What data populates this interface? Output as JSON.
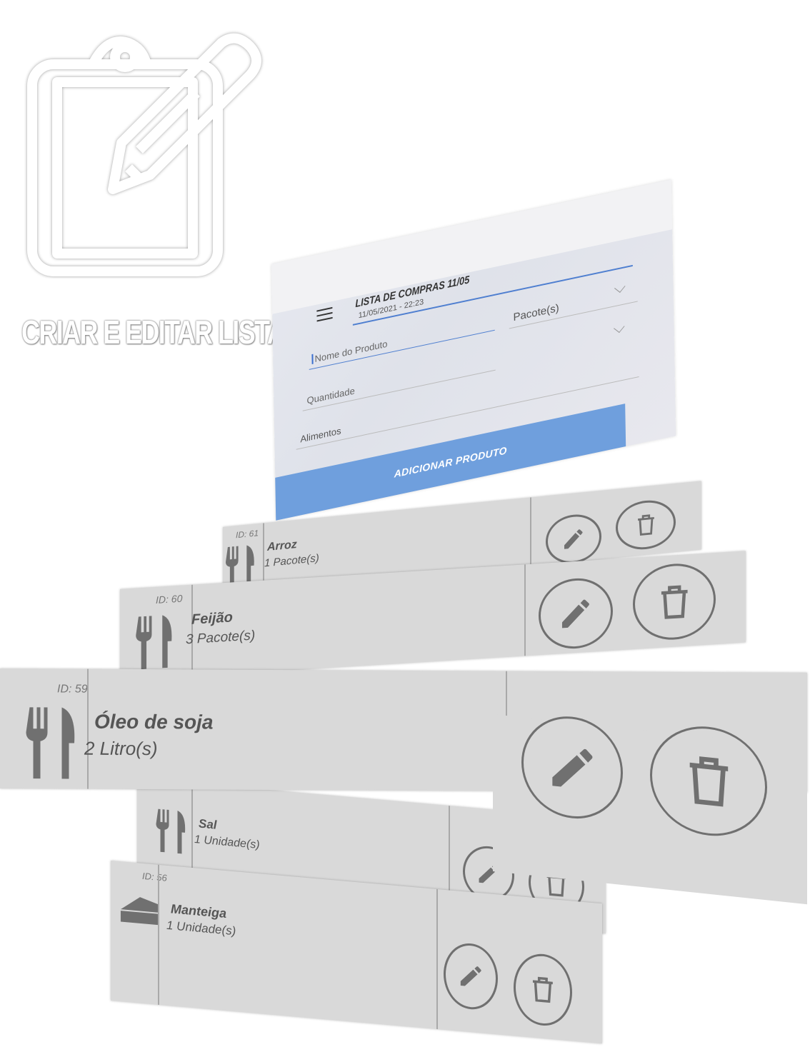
{
  "hero": {
    "title": "CRIAR E EDITAR LISTA",
    "icon": "clipboard-edit-icon"
  },
  "app": {
    "list_title": "LISTA DE COMPRAS 11/05",
    "list_datetime": "11/05/2021 - 22:23",
    "menu_icon": "hamburger-menu-icon",
    "form": {
      "product_name_placeholder": "Nome do Produto",
      "unit_selected": "Pacote(s)",
      "quantity_placeholder": "Quantidade",
      "category_selected": "Alimentos",
      "add_button_label": "ADICIONAR PRODUTO"
    }
  },
  "products": [
    {
      "id_label": "ID: 61",
      "name": "Arroz",
      "qty": "1 Pacote(s)",
      "icon": "fork-knife-icon"
    },
    {
      "id_label": "ID: 60",
      "name": "Feijão",
      "qty": "3 Pacote(s)",
      "icon": "fork-knife-icon"
    },
    {
      "id_label": "ID: 59",
      "name": "Óleo de soja",
      "qty": "2 Litro(s)",
      "icon": "fork-knife-icon"
    },
    {
      "id_label": "",
      "name": "Sal",
      "qty": "1 Unidade(s)",
      "icon": "fork-knife-icon"
    },
    {
      "id_label": "ID: 56",
      "name": "Manteiga",
      "qty": "1 Unidade(s)",
      "icon": "butter-icon"
    }
  ],
  "colors": {
    "accent": "#6f9fdd",
    "card_bg": "#d9d9d9",
    "icon_gray": "#707070"
  }
}
